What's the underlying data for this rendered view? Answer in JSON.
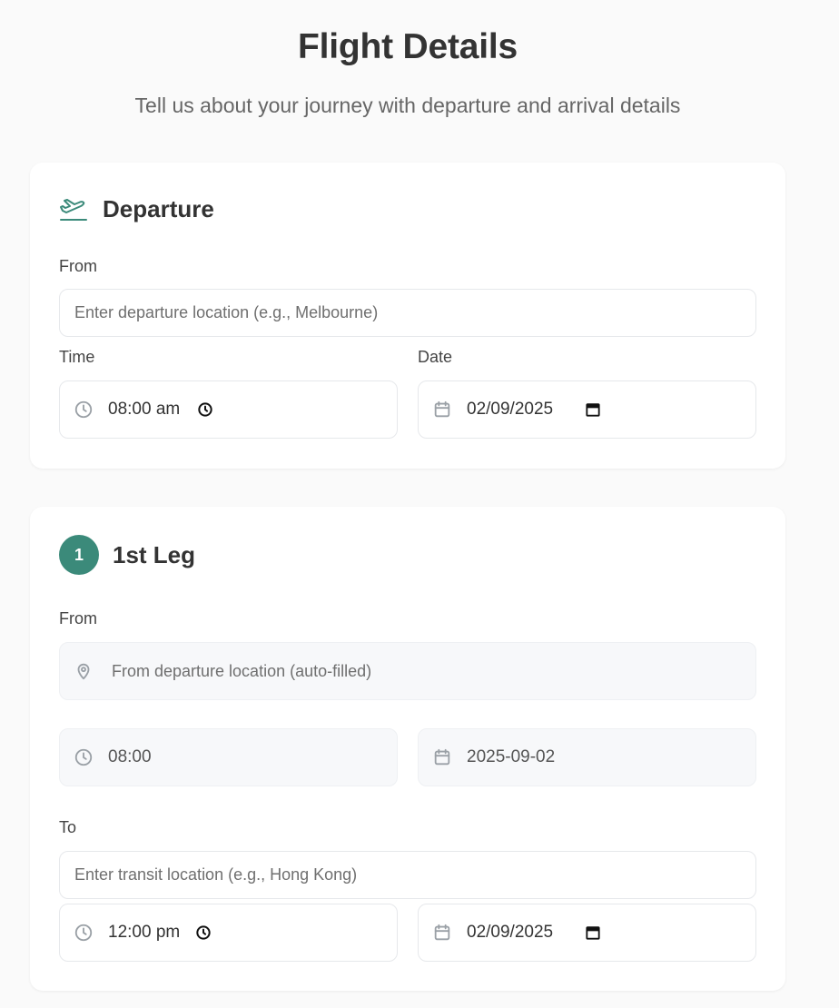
{
  "page": {
    "title": "Flight Details",
    "subtitle": "Tell us about your journey with departure and arrival details"
  },
  "departure": {
    "title": "Departure",
    "from_label": "From",
    "from_placeholder": "Enter departure location (e.g., Melbourne)",
    "time_label": "Time",
    "time_value": "08:00 am",
    "date_label": "Date",
    "date_value": "02/09/2025"
  },
  "leg1": {
    "badge": "1",
    "title": "1st Leg",
    "from_label": "From",
    "from_placeholder": "From departure location (auto-filled)",
    "from_time": "08:00",
    "from_date": "2025-09-02",
    "to_label": "To",
    "to_placeholder": "Enter transit location (e.g., Hong Kong)",
    "to_time": "12:00 pm",
    "to_date": "02/09/2025"
  },
  "colors": {
    "accent": "#3b8a7a",
    "background": "#fafafa",
    "card": "#ffffff"
  },
  "icons": [
    "plane-departure-icon",
    "clock-icon",
    "calendar-icon",
    "map-pin-icon"
  ]
}
